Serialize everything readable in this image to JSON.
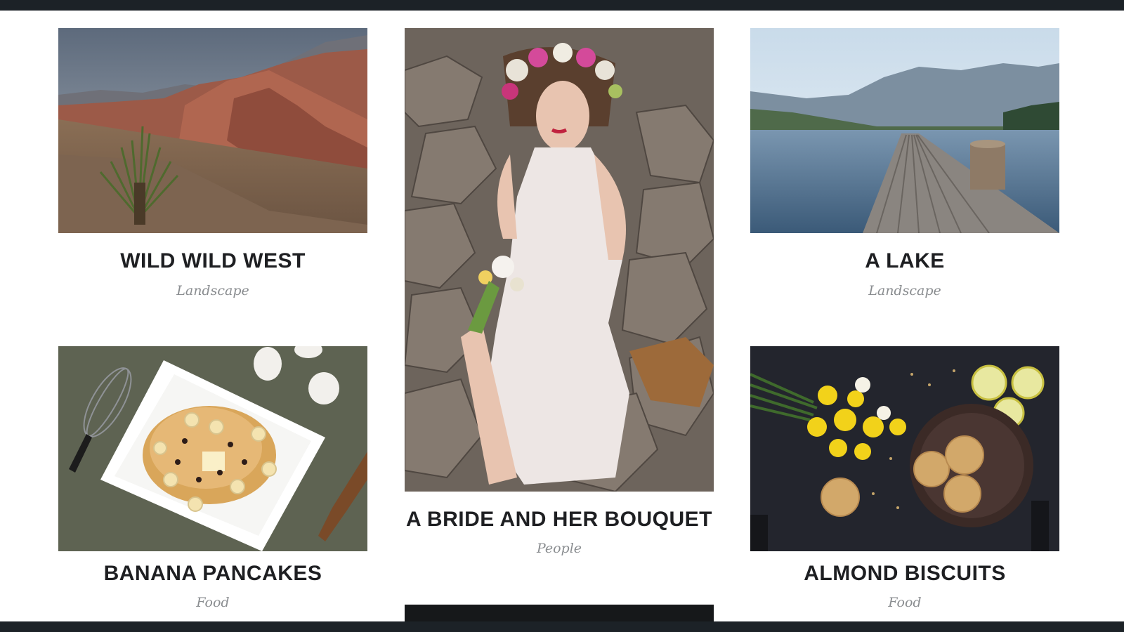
{
  "portfolio": {
    "items": [
      {
        "title": "WILD WILD WEST",
        "category": "Landscape",
        "image": "desert-canyon-photo"
      },
      {
        "title": "A BRIDE AND HER BOUQUET",
        "category": "People",
        "image": "bride-with-bouquet-photo"
      },
      {
        "title": "A LAKE",
        "category": "Landscape",
        "image": "lake-pier-photo"
      },
      {
        "title": "BANANA PANCAKES",
        "category": "Food",
        "image": "pancakes-plate-photo"
      },
      {
        "title": "ALMOND BISCUITS",
        "category": "Food",
        "image": "biscuits-daffodils-photo"
      }
    ]
  },
  "colors": {
    "frame_bar": "#1c2227",
    "title_text": "#1e1f22",
    "category_text": "#8a8d90",
    "background": "#ffffff"
  }
}
